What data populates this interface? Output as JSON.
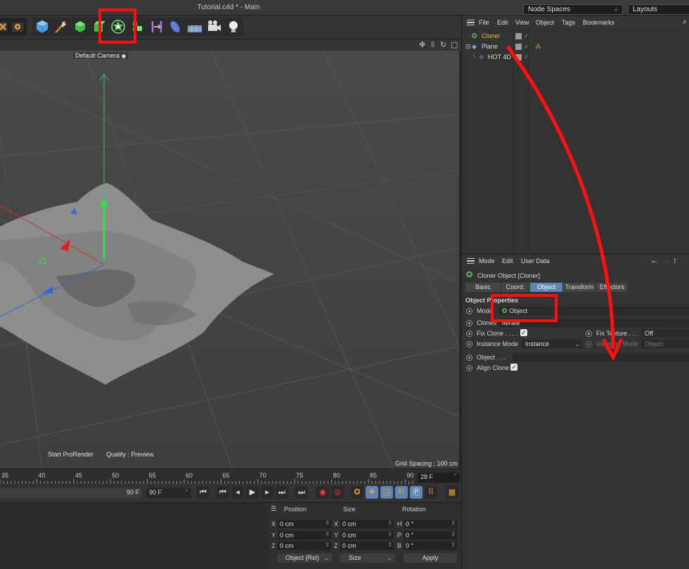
{
  "window": {
    "title": "Tutorial.c4d * - Main"
  },
  "header": {
    "node_spaces": "Node Spaces",
    "layouts": "Layouts"
  },
  "viewport": {
    "camera": "Default Camera",
    "start_prorender": "Start ProRender",
    "quality": "Quality : Preview",
    "grid_spacing": "Grid Spacing : 100 cm"
  },
  "timeline": {
    "ticks": [
      "35",
      "40",
      "45",
      "50",
      "55",
      "60",
      "65",
      "70",
      "75",
      "80",
      "85",
      "90"
    ],
    "current_frame": "28 F"
  },
  "playback": {
    "end_frame_a": "90 F",
    "end_frame_b": "90 F"
  },
  "coords": {
    "headers": {
      "position": "Position",
      "size": "Size",
      "rotation": "Rotation"
    },
    "axes_pos": [
      "X",
      "Y",
      "Z"
    ],
    "axes_rot": [
      "H",
      "P",
      "B"
    ],
    "position": [
      "0 cm",
      "0 cm",
      "0 cm"
    ],
    "size": [
      "0 cm",
      "0 cm",
      "0 cm"
    ],
    "rotation": [
      "0 °",
      "0 °",
      "0 °"
    ],
    "mode": "Object (Rel)",
    "size_mode": "Size",
    "apply": "Apply"
  },
  "object_manager": {
    "menu": [
      "File",
      "Edit",
      "View",
      "Object",
      "Tags",
      "Bookmarks"
    ],
    "objects": [
      {
        "name": "Cloner",
        "color": "#f2b92c"
      },
      {
        "name": "Plane",
        "color": "#dcdcdc"
      },
      {
        "name": "HOT 4D",
        "color": "#dcdcdc"
      }
    ]
  },
  "attribute_manager": {
    "menu": [
      "Mode",
      "Edit",
      "User Data"
    ],
    "title": "Cloner Object [Cloner]",
    "tabs": [
      "Basic",
      "Coord.",
      "Object",
      "Transform",
      "Effectors"
    ],
    "active_tab": "Object",
    "section": "Object Properties",
    "mode_label": "Mode",
    "mode_value": "Object",
    "clones_label": "Clones",
    "clones_value": "Iterate",
    "fix_clone_label": "Fix Clone . . . .",
    "fix_texture_label": "Fix Texture . . .",
    "fix_texture_value": "Off",
    "instance_mode_label": "Instance Mode",
    "instance_mode_value": "Instance",
    "viewport_mode_label": "Viewport Mode",
    "viewport_mode_value": "Object",
    "object_label": "Object . . .",
    "align_clone_label": "Align Clone"
  },
  "colors": {
    "annotation": "#ff1010",
    "accent": "#5b86b6",
    "cloner": "#f2b92c"
  }
}
